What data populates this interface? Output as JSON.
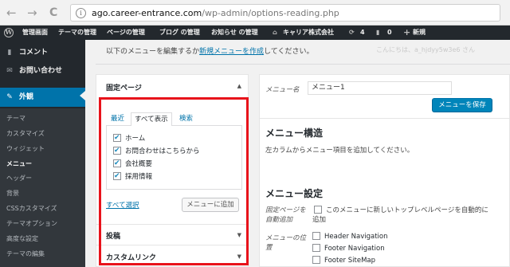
{
  "browser": {
    "back_icon": "←",
    "forward_icon": "→",
    "reload_icon": "C",
    "info_icon": "i",
    "url_host": "ago.career-entrance.com",
    "url_path": "/wp-admin/options-reading.php"
  },
  "adminbar": {
    "wp_logo": "W",
    "items": [
      "管理画面",
      "テーマの管理",
      "ページの管理",
      "ブログ の管理",
      "お知らせ の管理"
    ],
    "site_name": "キャリア株式会社",
    "updates_count": "4",
    "comments_count": "0",
    "new_label": "新規",
    "greeting": "こんにちは、a_hjdyy5w3e6 さん"
  },
  "sidebar": {
    "top_items": [
      {
        "label": "コメント",
        "icon": "comment-icon",
        "glyph": "▮"
      },
      {
        "label": "お問い合わせ",
        "icon": "mail-icon",
        "glyph": "✉"
      }
    ],
    "appearance": {
      "label": "外観",
      "icon": "brush-icon",
      "glyph": "✎"
    },
    "submenu": [
      "テーマ",
      "カスタマイズ",
      "ウィジェット",
      "メニュー",
      "ヘッダー",
      "背景",
      "CSSカスタマイズ",
      "テーマオプション",
      "高度な設定",
      "テーマの編集"
    ],
    "current_submenu": "メニュー"
  },
  "notice": {
    "text_before": "以下のメニューを編集するか",
    "link": "新規メニューを作成",
    "text_after": "してください。"
  },
  "left_panel": {
    "section_title": "固定ページ",
    "collapse_icon": "▲",
    "expand_icon": "▼",
    "tabs": [
      "最近",
      "すべて表示",
      "検索"
    ],
    "active_tab": "すべて表示",
    "pages": [
      {
        "label": "ホーム",
        "checked": true
      },
      {
        "label": "お問合わせはこちらから",
        "checked": true
      },
      {
        "label": "会社概要",
        "checked": true
      },
      {
        "label": "採用情報",
        "checked": true
      }
    ],
    "select_all": "すべて選択",
    "add_button": "メニューに追加",
    "other_sections": [
      "投稿",
      "カスタムリンク"
    ]
  },
  "right_panel": {
    "menu_name_label": "メニュー名",
    "menu_name_value": "メニュー1",
    "save_button": "メニューを保存",
    "structure_title": "メニュー構造",
    "structure_desc": "左カラムからメニュー項目を追加してください。",
    "settings_title": "メニュー設定",
    "auto_add_label_1": "固定ページを",
    "auto_add_label_2": "自動追加",
    "auto_add_text_1": "このメニューに新しいトップレベルページを自動的に",
    "auto_add_text_2": "追加",
    "location_label_1": "メニューの位",
    "location_label_2": "置",
    "locations": [
      "Header Navigation",
      "Footer Navigation",
      "Footer SiteMap"
    ]
  },
  "colors": {
    "admin_dark": "#23282d",
    "accent_blue": "#0073aa",
    "highlight_red": "#e8131b"
  }
}
